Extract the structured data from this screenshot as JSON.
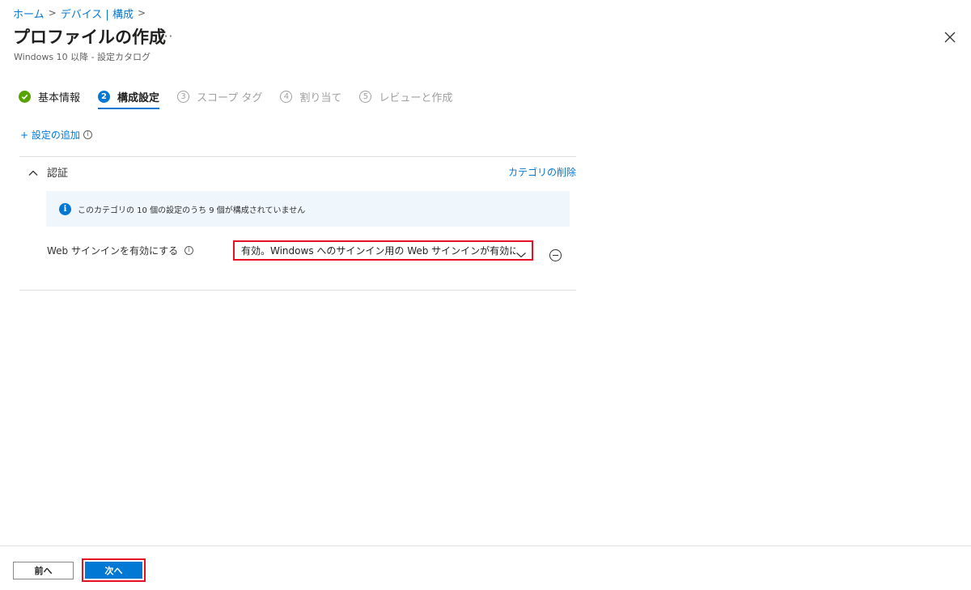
{
  "breadcrumb": {
    "home": "ホーム",
    "devices": "デバイス | 構成"
  },
  "header": {
    "title": "プロファイルの作成",
    "more": "···",
    "subtitle": "Windows 10 以降 - 設定カタログ"
  },
  "steps": [
    {
      "num": "✓",
      "label": "基本情報",
      "state": "done"
    },
    {
      "num": "2",
      "label": "構成設定",
      "state": "active"
    },
    {
      "num": "3",
      "label": "スコープ タグ",
      "state": "pending"
    },
    {
      "num": "4",
      "label": "割り当て",
      "state": "pending"
    },
    {
      "num": "5",
      "label": "レビューと作成",
      "state": "pending"
    }
  ],
  "add_setting": "+ 設定の追加",
  "category": {
    "title": "認証",
    "delete_label": "カテゴリの削除",
    "info_text": "このカテゴリの 10 個の設定のうち 9 個が構成されていません",
    "setting": {
      "label": "Web サインインを有効にする",
      "value": "有効。Windows へのサインイン用の Web サインインが有効になる"
    }
  },
  "footer": {
    "prev_label": "前へ",
    "next_label": "次へ"
  },
  "colors": {
    "accent": "#0078d4",
    "success": "#57a300",
    "highlight": "#e81123"
  }
}
